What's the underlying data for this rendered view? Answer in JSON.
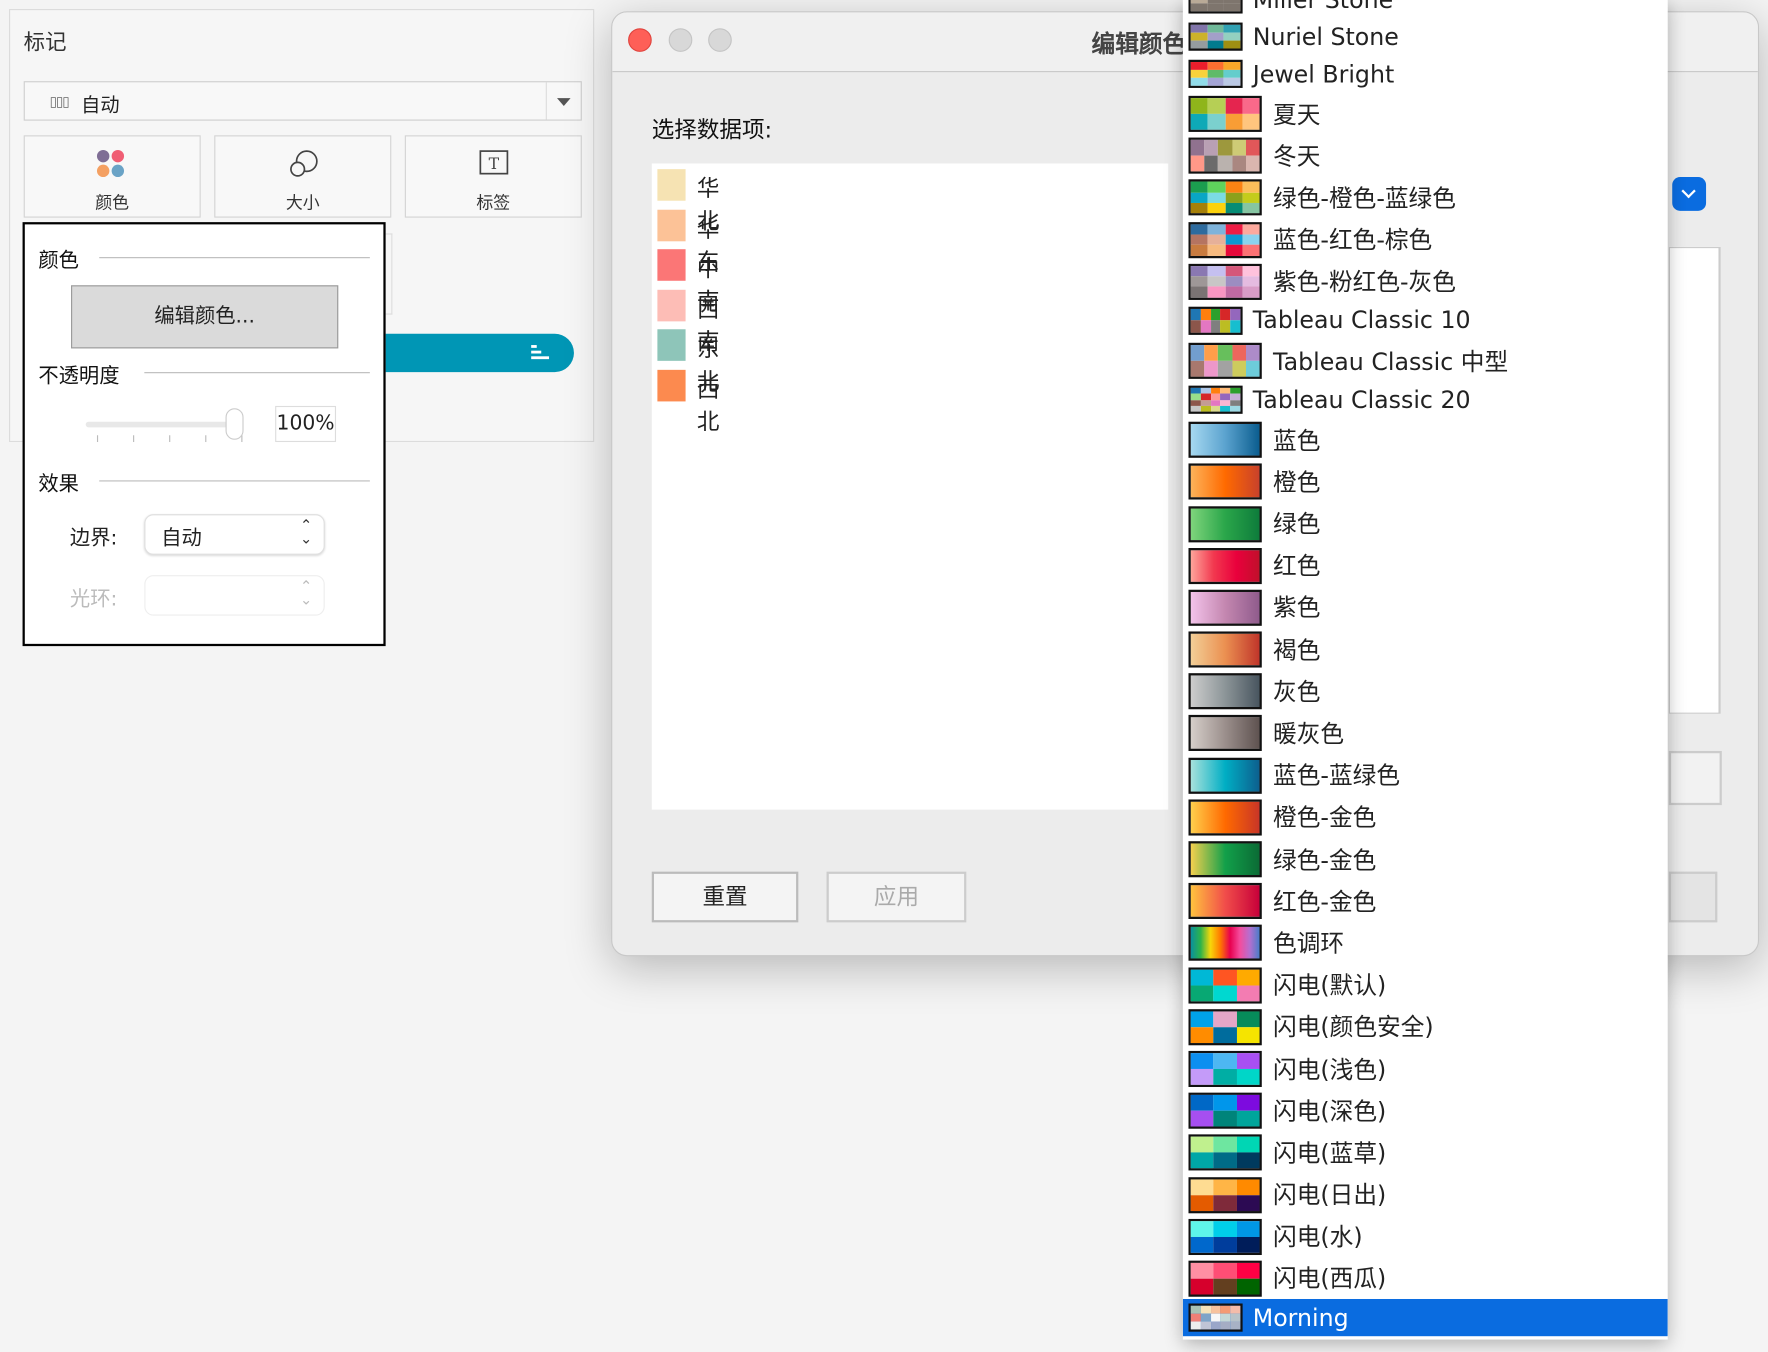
{
  "marks": {
    "title": "标记",
    "mark_type": "自动",
    "cards": [
      {
        "label": "颜色"
      },
      {
        "label": "大小"
      },
      {
        "label": "标签"
      }
    ],
    "popup": {
      "color_section": "颜色",
      "edit_colors_button": "编辑颜色...",
      "opacity_section": "不透明度",
      "opacity_value": "100%",
      "opacity_percent": 100,
      "effects_section": "效果",
      "border_label": "边界:",
      "border_value": "自动",
      "halo_label": "光环:",
      "halo_value": ""
    },
    "pill_color": "#0096b5"
  },
  "dialog": {
    "title": "编辑颜色",
    "select_label": "选择数据项:",
    "items": [
      {
        "label": "华北",
        "color": "#f6e3b3"
      },
      {
        "label": "华东",
        "color": "#fcc297"
      },
      {
        "label": "中南",
        "color": "#fb7676"
      },
      {
        "label": "西南",
        "color": "#fdbdb6"
      },
      {
        "label": "东北",
        "color": "#8ec5b9"
      },
      {
        "label": "西北",
        "color": "#fc8a4f"
      }
    ],
    "reset_button": "重置",
    "apply_button": "应用",
    "accent": "#0a6ce0"
  },
  "palette_list": {
    "selected": "Morning",
    "items": [
      {
        "label": "Miller Stone",
        "size": "small",
        "cols": 3,
        "colors": [
          "#b66353",
          "#f5a25d",
          "#d7ce9f",
          "#b9aa97",
          "#7e756d",
          "#7e756d",
          "#7e756d",
          "#7e756d",
          "#7e756d"
        ]
      },
      {
        "label": "Nuriel Stone",
        "size": "small",
        "cols": 3,
        "colors": [
          "#8175aa",
          "#6fb899",
          "#31a1b3",
          "#ccb22b",
          "#a39fc9",
          "#94d0c0",
          "#959c9e",
          "#027b8e",
          "#9f8f12"
        ]
      },
      {
        "label": "Jewel Bright",
        "size": "small",
        "cols": 3,
        "colors": [
          "#eb1e2c",
          "#fd6f30",
          "#f9a729",
          "#f9d23c",
          "#5fbb68",
          "#64cdcc",
          "#91dcea",
          "#a4a4d5",
          "#bbc9e5"
        ]
      },
      {
        "label": "夏天",
        "size": "big",
        "cols": 4,
        "colors": [
          "#8fb51b",
          "#b6cf55",
          "#e5254f",
          "#f9698a",
          "#0ea9b7",
          "#7bd0ce",
          "#f99d35",
          "#ffc57e"
        ]
      },
      {
        "label": "冬天",
        "size": "big",
        "cols": 5,
        "colors": [
          "#90728f",
          "#b9a0b4",
          "#9d983d",
          "#cecb76",
          "#e15759",
          "#ff9888",
          "#6b6b6b",
          "#bab2ae",
          "#aa8780",
          "#dab6af"
        ]
      },
      {
        "label": "绿色-橙色-蓝绿色",
        "size": "big",
        "cols": 4,
        "colors": [
          "#1b9e4f",
          "#5fd35c",
          "#fb8313",
          "#fcbe5a",
          "#09a6c5",
          "#7bdbe3",
          "#8ca11b",
          "#c4cc1c",
          "#a68009",
          "#fcd20d",
          "#068c75",
          "#86c5a2"
        ]
      },
      {
        "label": "蓝色-红色-棕色",
        "size": "big",
        "cols": 4,
        "colors": [
          "#2e6b9e",
          "#7eb3db",
          "#ee1c44",
          "#fca99d",
          "#b57461",
          "#e6b099",
          "#0c97d2",
          "#8bd3ee",
          "#c87b3f",
          "#f6ba7f",
          "#e5093a",
          "#fc7274"
        ]
      },
      {
        "label": "紫色-粉红色-灰色",
        "size": "big",
        "cols": 4,
        "colors": [
          "#8a78b2",
          "#c5c0f0",
          "#d5577a",
          "#ffc2dc",
          "#9e9797",
          "#c8c6c6",
          "#9c8dc1",
          "#e5bbe0",
          "#7a7373",
          "#f996c2",
          "#c16aa2",
          "#d99cc7"
        ]
      },
      {
        "label": "Tableau Classic 10",
        "size": "small",
        "cols": 5,
        "colors": [
          "#1f77b4",
          "#ff7f0e",
          "#2ca02c",
          "#d62728",
          "#9467bd",
          "#8c564b",
          "#e377c2",
          "#7f7f7f",
          "#bcbd22",
          "#17becf"
        ]
      },
      {
        "label": "Tableau Classic 中型",
        "size": "big",
        "cols": 5,
        "colors": [
          "#729ece",
          "#ff9e4a",
          "#67bf5c",
          "#ed665d",
          "#ad8bc9",
          "#a8786e",
          "#ed97ca",
          "#a2a2a2",
          "#cdcc5d",
          "#6dccda"
        ]
      },
      {
        "label": "Tableau Classic 20",
        "size": "small",
        "cols": 5,
        "colors": [
          "#1f77b4",
          "#aec7e8",
          "#ff7f0e",
          "#ffbb78",
          "#2ca02c",
          "#98df8a",
          "#d62728",
          "#ff9896",
          "#9467bd",
          "#c5b0d5",
          "#8c564b",
          "#c49c94",
          "#e377c2",
          "#f7b6d2",
          "#7f7f7f",
          "#c7c7c7",
          "#bcbd22",
          "#dbdb8d",
          "#17becf",
          "#9edae5"
        ]
      },
      {
        "label": "蓝色",
        "size": "big",
        "gradient": [
          "#a6d8f0",
          "#5ba3cf",
          "#0b5d8f"
        ]
      },
      {
        "label": "橙色",
        "size": "big",
        "gradient": [
          "#fdb35a",
          "#ff6a00",
          "#c9412b"
        ]
      },
      {
        "label": "绿色",
        "size": "big",
        "gradient": [
          "#7fd57c",
          "#2aa64a",
          "#0e7c3b"
        ]
      },
      {
        "label": "红色",
        "size": "big",
        "gradient": [
          "#fea59b",
          "#f2384f",
          "#e9003c",
          "#c1102b"
        ]
      },
      {
        "label": "紫色",
        "size": "big",
        "gradient": [
          "#f3c3ea",
          "#c487b0",
          "#8f5b8c"
        ]
      },
      {
        "label": "褐色",
        "size": "big",
        "gradient": [
          "#f2cf97",
          "#eb9051",
          "#c0352a"
        ]
      },
      {
        "label": "灰色",
        "size": "big",
        "gradient": [
          "#cdcdcd",
          "#8c9598",
          "#48555f"
        ]
      },
      {
        "label": "暖灰色",
        "size": "big",
        "gradient": [
          "#d6cfca",
          "#9b8f8c",
          "#5e5250"
        ]
      },
      {
        "label": "蓝色-蓝绿色",
        "size": "big",
        "gradient": [
          "#a8e2dc",
          "#00aec4",
          "#0d5f8e"
        ]
      },
      {
        "label": "橙色-金色",
        "size": "big",
        "gradient": [
          "#ffd04d",
          "#ff6a00",
          "#c93527"
        ]
      },
      {
        "label": "绿色-金色",
        "size": "big",
        "gradient": [
          "#f5d04e",
          "#12a04a",
          "#0b6b35"
        ]
      },
      {
        "label": "红色-金色",
        "size": "big",
        "gradient": [
          "#ffc33e",
          "#f14d4a",
          "#c7003a"
        ]
      },
      {
        "label": "色调环",
        "size": "big",
        "gradient": [
          "#0a8f9e",
          "#2db34a",
          "#f7d70a",
          "#ff7a00",
          "#e8004f",
          "#f44c9d",
          "#b56fcf",
          "#4a7dc9"
        ]
      },
      {
        "label": "闪电(默认)",
        "size": "big",
        "cols": 3,
        "colors": [
          "#00b8d6",
          "#ff5522",
          "#ffaa00",
          "#08a873",
          "#00d8d0",
          "#f37cb2"
        ]
      },
      {
        "label": "闪电(颜色安全)",
        "size": "big",
        "cols": 3,
        "colors": [
          "#00a2e8",
          "#e4a6c7",
          "#068b5a",
          "#ff8c00",
          "#006c9d",
          "#f5e400"
        ]
      },
      {
        "label": "闪电(浅色)",
        "size": "big",
        "cols": 3,
        "colors": [
          "#0c8ff0",
          "#4db7f2",
          "#a84ff2",
          "#c49bf9",
          "#00aea4",
          "#00d6c8"
        ]
      },
      {
        "label": "闪电(深色)",
        "size": "big",
        "cols": 3,
        "colors": [
          "#0068c6",
          "#0096eb",
          "#7d0bdf",
          "#a64ff0",
          "#00847a",
          "#00a59b"
        ]
      },
      {
        "label": "闪电(蓝草)",
        "size": "big",
        "cols": 3,
        "colors": [
          "#c0f08e",
          "#6ee6a0",
          "#00d6b4",
          "#00a7a7",
          "#006b87",
          "#003a5e"
        ]
      },
      {
        "label": "闪电(日出)",
        "size": "big",
        "cols": 3,
        "colors": [
          "#fedc92",
          "#ffb546",
          "#ff8a00",
          "#e45b00",
          "#7f2a3a",
          "#2c0a53"
        ]
      },
      {
        "label": "闪电(水)",
        "size": "big",
        "cols": 3,
        "colors": [
          "#5ef5ea",
          "#00cfea",
          "#0098e6",
          "#0068cc",
          "#003d9c",
          "#001d5a"
        ]
      },
      {
        "label": "闪电(西瓜)",
        "size": "big",
        "cols": 3,
        "colors": [
          "#ff8fa3",
          "#ff4e75",
          "#ff0044",
          "#d6002c",
          "#633f1f",
          "#006400"
        ]
      },
      {
        "label": "Morning",
        "size": "small",
        "cols": 5,
        "colors": [
          "#a8c2b4",
          "#f6e2b9",
          "#f7c29d",
          "#f49a73",
          "#f4bcaa",
          "#f07f76",
          "#7ea3c8",
          "#f7f7f7",
          "#c5d8d6",
          "#b8c3c9",
          "#eeeeee",
          "#c0c4d6",
          "#9aa6c9",
          "#a5adc4",
          "#a8b2c5"
        ]
      }
    ]
  }
}
